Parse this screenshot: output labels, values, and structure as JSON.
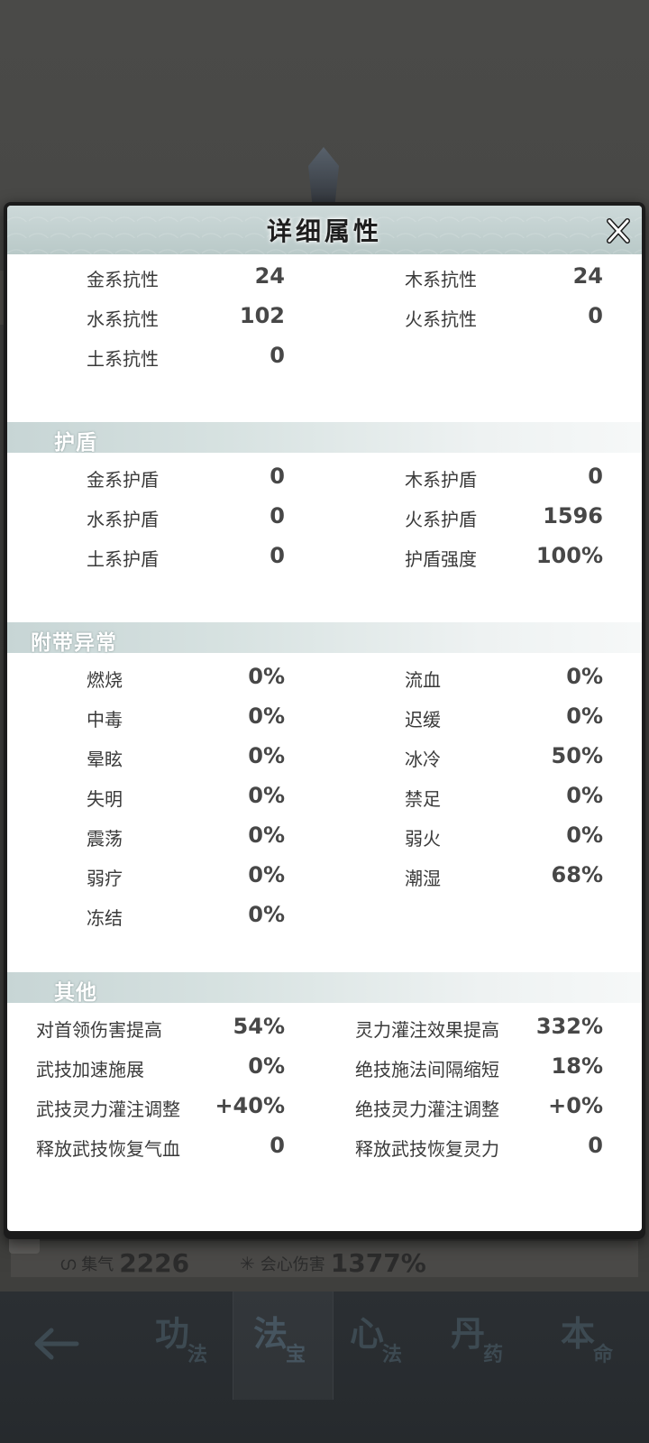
{
  "dialog": {
    "title": "详细属性"
  },
  "resist": {
    "rows": [
      {
        "l_label": "金系抗性",
        "l_value": "24",
        "r_label": "木系抗性",
        "r_value": "24"
      },
      {
        "l_label": "水系抗性",
        "l_value": "102",
        "r_label": "火系抗性",
        "r_value": "0"
      },
      {
        "l_label": "土系抗性",
        "l_value": "0"
      }
    ]
  },
  "shield": {
    "title": "护盾",
    "rows": [
      {
        "l_label": "金系护盾",
        "l_value": "0",
        "r_label": "木系护盾",
        "r_value": "0"
      },
      {
        "l_label": "水系护盾",
        "l_value": "0",
        "r_label": "火系护盾",
        "r_value": "1596"
      },
      {
        "l_label": "土系护盾",
        "l_value": "0",
        "r_label": "护盾强度",
        "r_value": "100%"
      }
    ]
  },
  "ailment": {
    "title": "附带异常",
    "rows": [
      {
        "l_label": "燃烧",
        "l_value": "0%",
        "r_label": "流血",
        "r_value": "0%"
      },
      {
        "l_label": "中毒",
        "l_value": "0%",
        "r_label": "迟缓",
        "r_value": "0%"
      },
      {
        "l_label": "晕眩",
        "l_value": "0%",
        "r_label": "冰冷",
        "r_value": "50%"
      },
      {
        "l_label": "失明",
        "l_value": "0%",
        "r_label": "禁足",
        "r_value": "0%"
      },
      {
        "l_label": "震荡",
        "l_value": "0%",
        "r_label": "弱火",
        "r_value": "0%"
      },
      {
        "l_label": "弱疗",
        "l_value": "0%",
        "r_label": "潮湿",
        "r_value": "68%"
      },
      {
        "l_label": "冻结",
        "l_value": "0%"
      }
    ]
  },
  "other": {
    "title": "其他",
    "rows": [
      {
        "l_label": "对首领伤害提高",
        "l_value": "54%",
        "r_label": "灵力灌注效果提高",
        "r_value": "332%"
      },
      {
        "l_label": "武技加速施展",
        "l_value": "0%",
        "r_label": "绝技施法间隔缩短",
        "r_value": "18%"
      },
      {
        "l_label": "武技灵力灌注调整",
        "l_value": "+40%",
        "r_label": "绝技灵力灌注调整",
        "r_value": "+0%"
      },
      {
        "l_label": "释放武技恢复气血",
        "l_value": "0",
        "r_label": "释放武技恢复灵力",
        "r_value": "0"
      }
    ]
  },
  "stats": {
    "help": "?",
    "qi_label": "集气",
    "qi_value": "2226",
    "crit_label": "会心伤害",
    "crit_value": "1377%"
  },
  "nav": {
    "items": [
      {
        "main": "功",
        "sub": "法"
      },
      {
        "main": "法",
        "sub": "宝"
      },
      {
        "main": "心",
        "sub": "法"
      },
      {
        "main": "丹",
        "sub": "药"
      },
      {
        "main": "本",
        "sub": "命"
      }
    ]
  },
  "colors": {
    "accent": "#c7d5d5",
    "text": "#3a3a3a",
    "value": "#474747",
    "nav_bg": "#2b2f33"
  }
}
